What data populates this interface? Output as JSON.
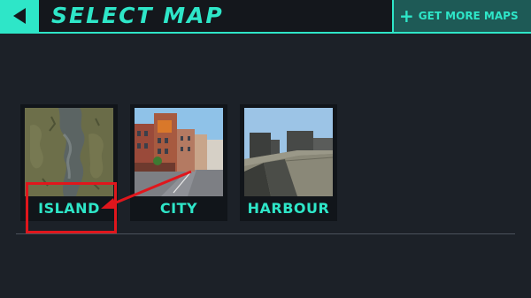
{
  "header": {
    "back_icon": "left-triangle-icon",
    "title": "SELECT MAP",
    "get_more_label": "GET MORE MAPS",
    "get_more_icon": "plus-icon"
  },
  "maps": [
    {
      "label": "ISLAND",
      "thumb": "island-aerial-terrain"
    },
    {
      "label": "CITY",
      "thumb": "city-street-buildings"
    },
    {
      "label": "HARBOUR",
      "thumb": "harbour-stone-buildings"
    }
  ],
  "colors": {
    "accent": "#2ee6c8",
    "background": "#1c2128",
    "highlight": "#e0161c"
  }
}
